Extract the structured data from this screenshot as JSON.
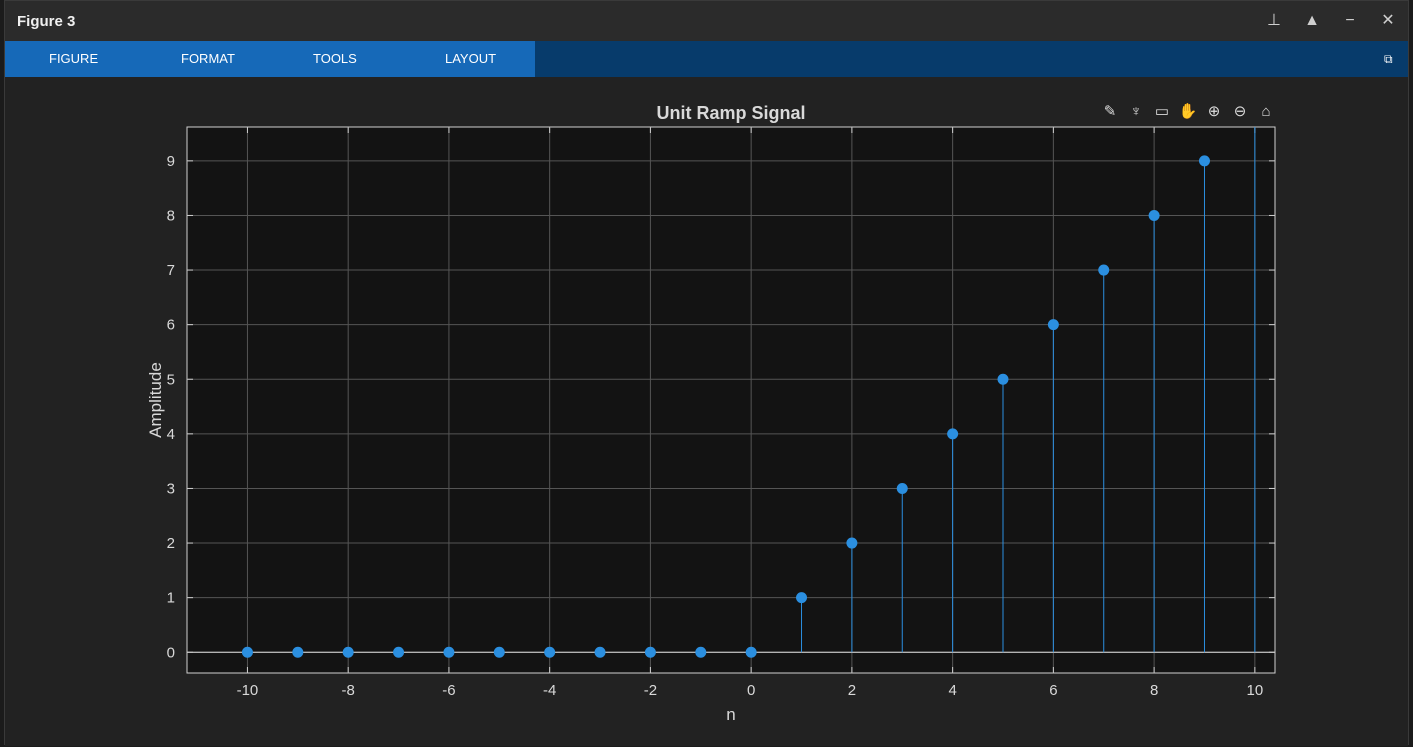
{
  "window": {
    "title": "Figure 3"
  },
  "ribbon": {
    "tabs": [
      "FIGURE",
      "FORMAT",
      "TOOLS",
      "LAYOUT"
    ]
  },
  "icons": {
    "window_controls": [
      "pin-icon",
      "collapse-icon",
      "minimize-icon",
      "close-icon"
    ],
    "axes_toolbar": [
      "export-icon",
      "brush-icon",
      "datatip-icon",
      "pan-icon",
      "zoom-in-icon",
      "zoom-out-icon",
      "home-icon"
    ]
  },
  "colors": {
    "stem": "#2b8fe0",
    "axes_bg": "#131313",
    "figure_bg": "#222222",
    "text": "#d9d9d9"
  },
  "chart_data": {
    "type": "stem",
    "title": "Unit Ramp Signal",
    "xlabel": "n",
    "ylabel": "Amplitude",
    "x": [
      -10,
      -9,
      -8,
      -7,
      -6,
      -5,
      -4,
      -3,
      -2,
      -1,
      0,
      1,
      2,
      3,
      4,
      5,
      6,
      7,
      8,
      9,
      10
    ],
    "y": [
      0,
      0,
      0,
      0,
      0,
      0,
      0,
      0,
      0,
      0,
      0,
      1,
      2,
      3,
      4,
      5,
      6,
      7,
      8,
      9,
      10
    ],
    "xlim": [
      -11.2,
      10.4
    ],
    "ylim": [
      -0.38,
      9.62
    ],
    "xticks": [
      -10,
      -8,
      -6,
      -4,
      -2,
      0,
      2,
      4,
      6,
      8,
      10
    ],
    "yticks": [
      0,
      1,
      2,
      3,
      4,
      5,
      6,
      7,
      8,
      9
    ],
    "grid": true
  }
}
